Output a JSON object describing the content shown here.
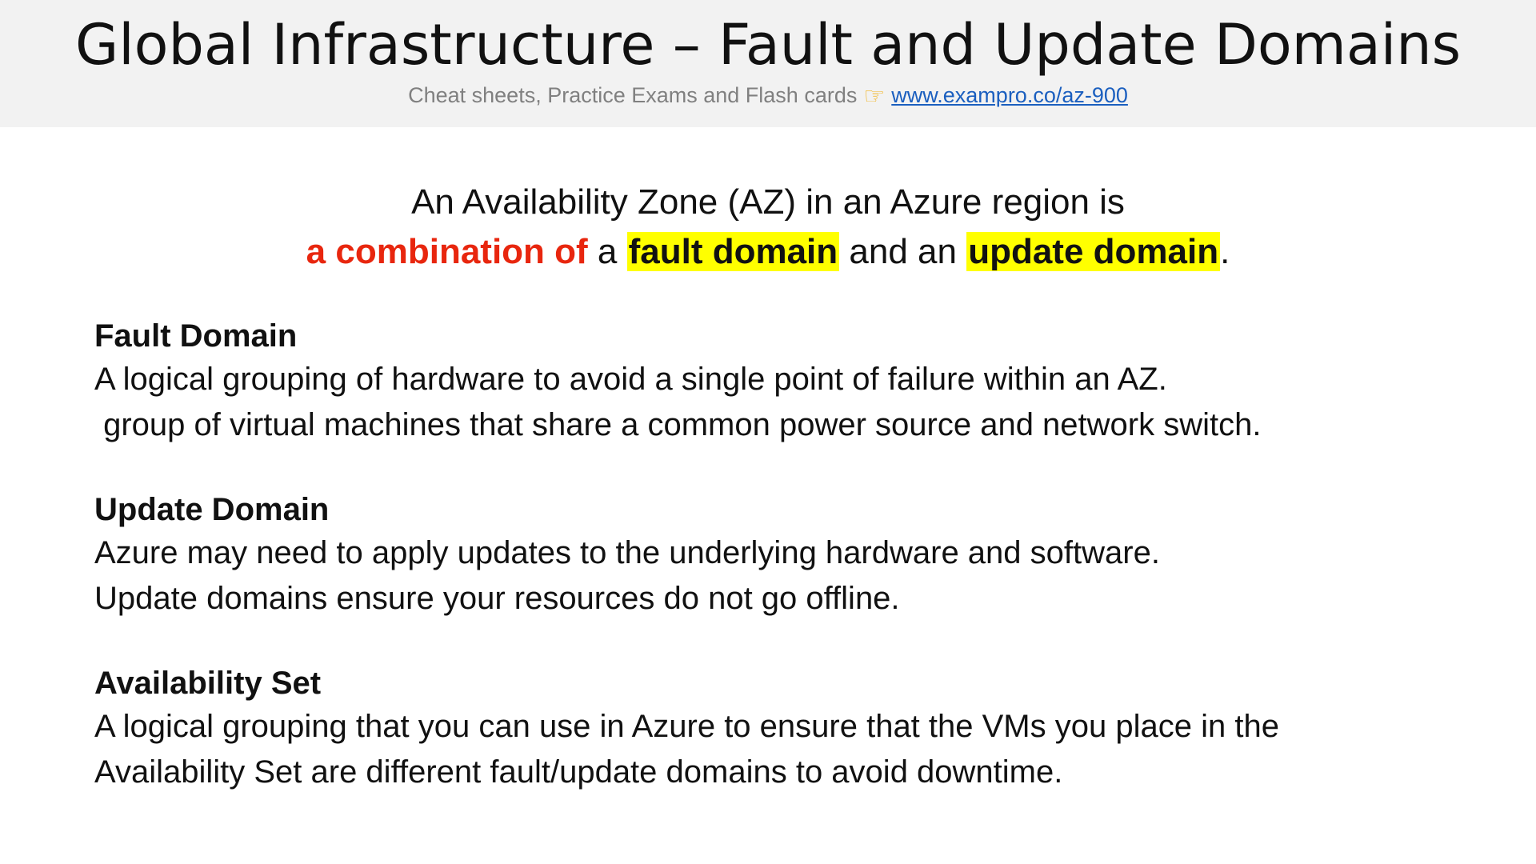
{
  "header": {
    "title": "Global Infrastructure – Fault and Update Domains",
    "subtitle_text": "Cheat sheets, Practice Exams and Flash cards",
    "subtitle_icon": "pointing-hand-icon",
    "link_text": "www.exampro.co/az-900"
  },
  "intro": {
    "line1": "An Availability Zone (AZ) in an Azure region is",
    "red_phrase": "a combination of",
    "a_word": " a ",
    "highlight1": "fault domain",
    "and_an": " and an ",
    "highlight2": "update domain",
    "period": "."
  },
  "sections": [
    {
      "heading": "Fault Domain",
      "lines": [
        "A logical grouping of hardware to avoid a single point of failure within an AZ.",
        " group of virtual machines that share a common power source and network switch."
      ]
    },
    {
      "heading": "Update Domain",
      "lines": [
        "Azure may need to apply updates to the underlying hardware and software.",
        "Update domains ensure your resources do not go offline."
      ]
    },
    {
      "heading": "Availability Set",
      "lines": [
        "A logical grouping that you can use in Azure to ensure that the VMs you place in the",
        "Availability Set are different fault/update domains to avoid downtime."
      ]
    }
  ],
  "colors": {
    "header_bg": "#f2f2f2",
    "highlight": "#ffff00",
    "accent_red": "#e8260e",
    "link": "#1b5fbf"
  }
}
